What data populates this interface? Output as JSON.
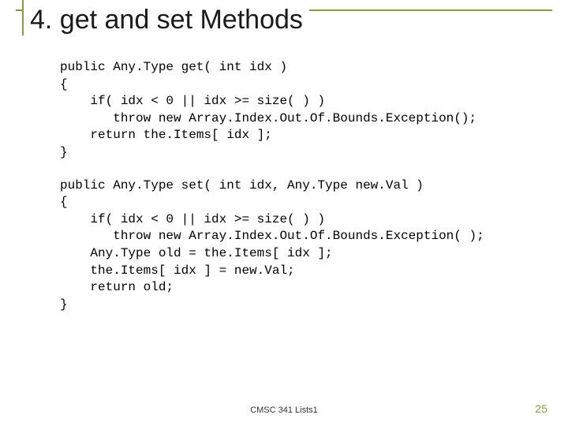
{
  "title": "4. get and set Methods",
  "code": {
    "get": "public Any.Type get( int idx )\n{\n    if( idx < 0 || idx >= size( ) )\n       throw new Array.Index.Out.Of.Bounds.Exception();\n    return the.Items[ idx ];\n}",
    "set": "public Any.Type set( int idx, Any.Type new.Val )\n{\n    if( idx < 0 || idx >= size( ) )\n       throw new Array.Index.Out.Of.Bounds.Exception( );\n    Any.Type old = the.Items[ idx ];\n    the.Items[ idx ] = new.Val;\n    return old;\n}"
  },
  "footer": {
    "text": "CMSC 341 Lists1",
    "page": "25"
  }
}
